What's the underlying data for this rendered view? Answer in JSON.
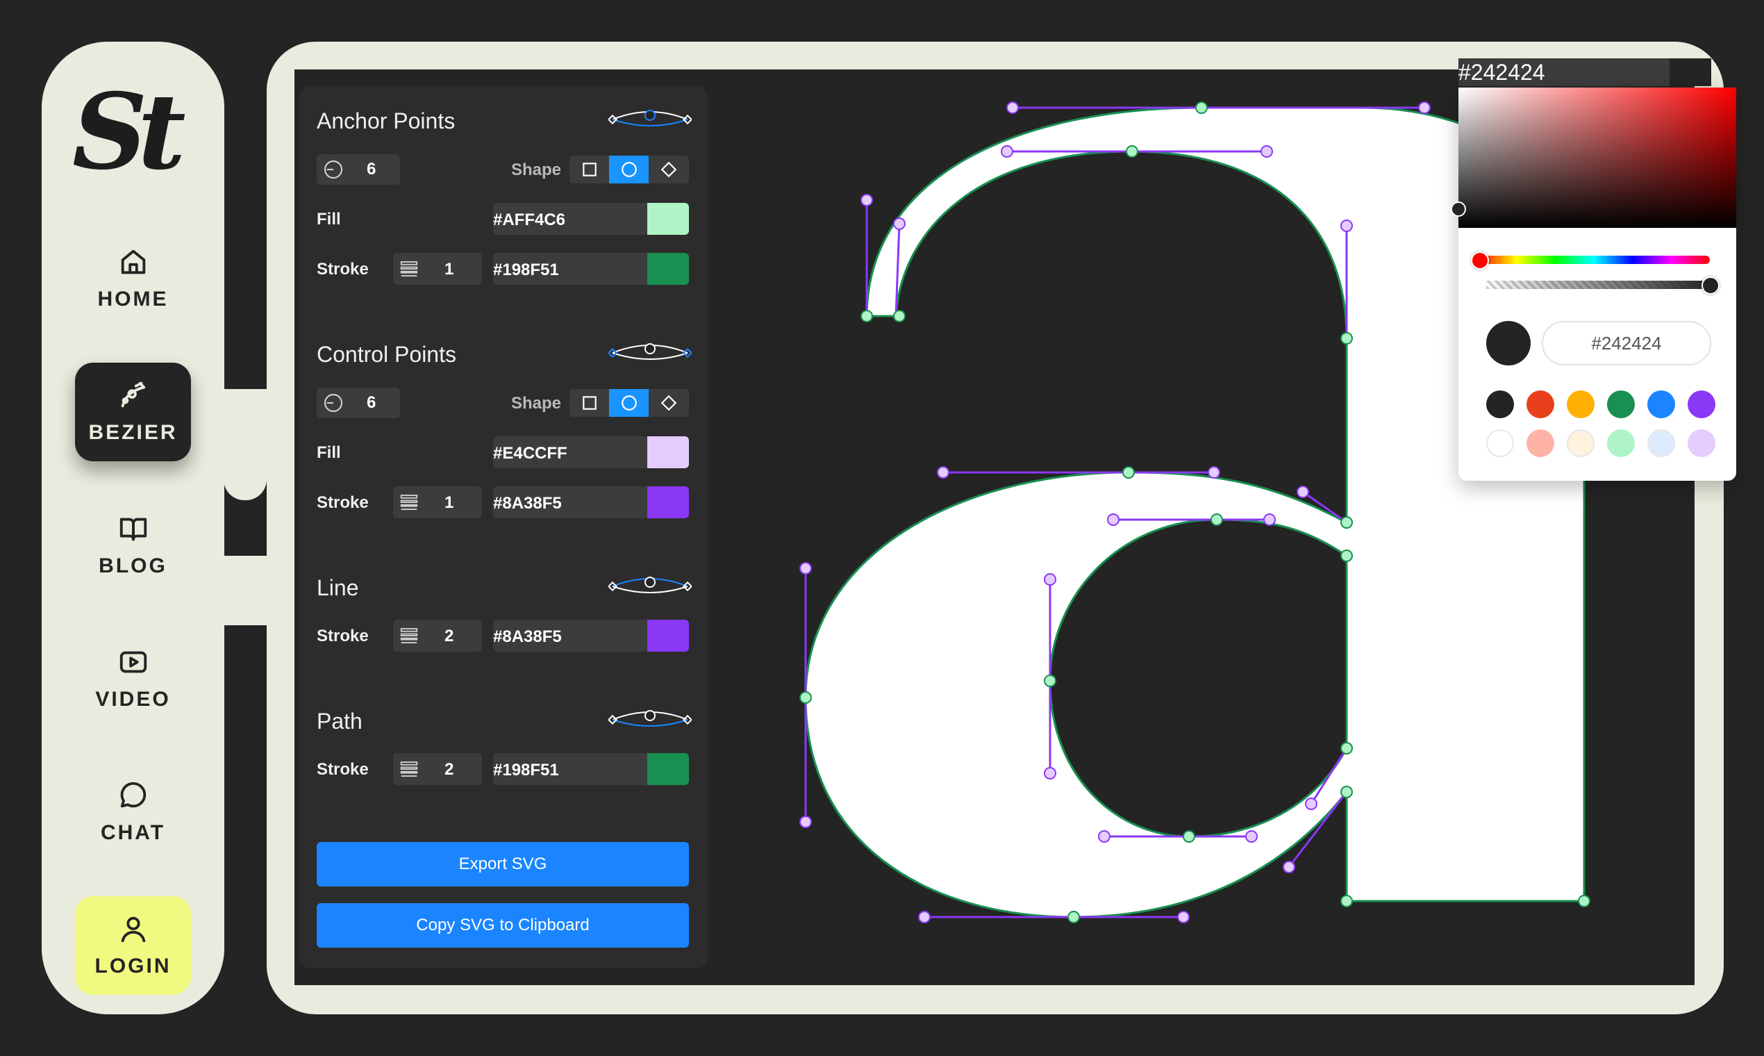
{
  "logo": {
    "text": "St"
  },
  "nav": [
    {
      "label": "HOME",
      "icon": "home-icon"
    },
    {
      "label": "BEZIER",
      "icon": "bezier-icon",
      "active": true
    },
    {
      "label": "BLOG",
      "icon": "book-icon"
    },
    {
      "label": "VIDEO",
      "icon": "video-icon"
    },
    {
      "label": "CHAT",
      "icon": "chat-icon"
    },
    {
      "label": "LOGIN",
      "icon": "user-icon"
    }
  ],
  "panel": {
    "anchor": {
      "title": "Anchor Points",
      "size": "6",
      "shape_label": "Shape",
      "fill_label": "Fill",
      "fill": "#AFF4C6",
      "stroke_label": "Stroke",
      "stroke_width": "1",
      "stroke": "#198F51"
    },
    "control": {
      "title": "Control Points",
      "size": "6",
      "shape_label": "Shape",
      "fill_label": "Fill",
      "fill": "#E4CCFF",
      "stroke_label": "Stroke",
      "stroke_width": "1",
      "stroke": "#8A38F5"
    },
    "line": {
      "title": "Line",
      "stroke_label": "Stroke",
      "stroke_width": "2",
      "stroke": "#8A38F5"
    },
    "path": {
      "title": "Path",
      "stroke_label": "Stroke",
      "stroke_width": "2",
      "stroke": "#198F51"
    },
    "export_label": "Export SVG",
    "copy_label": "Copy SVG to Clipboard"
  },
  "picker": {
    "hex_top": "#242424",
    "hex_value": "#242424",
    "swatches_row1": [
      "#242424",
      "#E8401C",
      "#FFB000",
      "#198F51",
      "#1A85FF",
      "#8A38F5"
    ],
    "swatches_row2": [
      "#FFFFFF",
      "#FFB3A7",
      "#FFF3DE",
      "#AFF4C6",
      "#DDEBFF",
      "#E4CCFF"
    ]
  },
  "colors": {
    "sidebar_bg": "#E9EBDE",
    "canvas_bg": "#242424",
    "accent_blue": "#1A85FF",
    "login_bg": "#F1FA80"
  }
}
